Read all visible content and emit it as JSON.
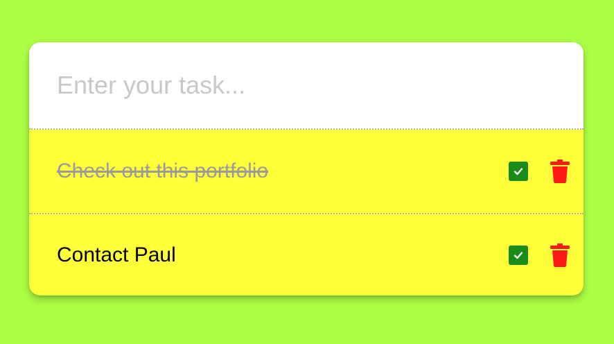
{
  "input": {
    "placeholder": "Enter your task...",
    "value": ""
  },
  "tasks": [
    {
      "text": "Check out this portfolio",
      "completed": true
    },
    {
      "text": "Contact Paul",
      "completed": false
    }
  ],
  "icons": {
    "complete": "check-square-icon",
    "delete": "trash-icon"
  },
  "colors": {
    "background": "#adff45",
    "card": "#ffff3a",
    "complete": "#1a8a18",
    "delete": "#ff1a1a",
    "completed_text": "#9a9a9a"
  }
}
